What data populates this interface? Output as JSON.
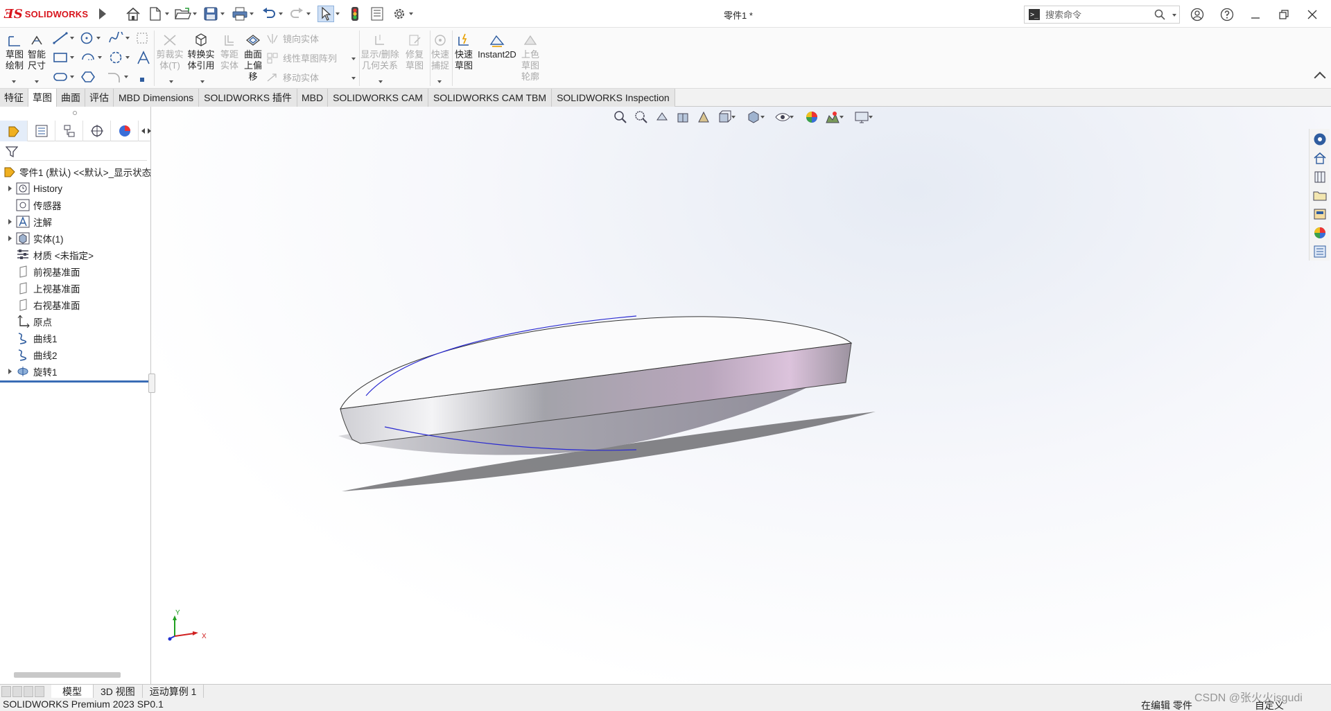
{
  "app": {
    "logo_ds": "ƎS",
    "logo_text": "SOLIDWORKS",
    "document_title": "零件1 *"
  },
  "search": {
    "placeholder": "搜索命令"
  },
  "command_manager": {
    "sketch_label": "草图\n绘制",
    "smart_dim_label": "智能\n尺寸",
    "trim_label": "剪裁实\n体(T)",
    "convert_label": "转换实\n体引用",
    "offset_label": "等距\n实体",
    "surface_offset_label": "曲面\n上偏\n移",
    "mirror_label": "镜向实体",
    "linear_pattern_label": "线性草图阵列",
    "move_label": "移动实体",
    "show_relations_label": "显示/删除\n几何关系",
    "repair_label": "修复\n草图",
    "quick_snap_label": "快速\n捕捉",
    "rapid_sketch_label": "快速\n草图",
    "instant2d_label": "Instant2D",
    "shaded_sketch_label": "上色\n草图\n轮廓"
  },
  "tabs": [
    {
      "label": "特征"
    },
    {
      "label": "草图"
    },
    {
      "label": "曲面"
    },
    {
      "label": "评估"
    },
    {
      "label": "MBD Dimensions"
    },
    {
      "label": "SOLIDWORKS 插件"
    },
    {
      "label": "MBD"
    },
    {
      "label": "SOLIDWORKS CAM"
    },
    {
      "label": "SOLIDWORKS CAM TBM"
    },
    {
      "label": "SOLIDWORKS Inspection"
    }
  ],
  "active_tab": "草图",
  "feature_tree": {
    "root": "零件1 (默认) <<默认>_显示状态",
    "items": [
      {
        "label": "History",
        "icon": "history-icon"
      },
      {
        "label": "传感器",
        "icon": "sensor-icon"
      },
      {
        "label": "注解",
        "icon": "annotation-icon"
      },
      {
        "label": "实体(1)",
        "icon": "solid-bodies-icon"
      },
      {
        "label": "材质 <未指定>",
        "icon": "material-icon"
      },
      {
        "label": "前视基准面",
        "icon": "plane-icon"
      },
      {
        "label": "上视基准面",
        "icon": "plane-icon"
      },
      {
        "label": "右视基准面",
        "icon": "plane-icon"
      },
      {
        "label": "原点",
        "icon": "origin-icon"
      },
      {
        "label": "曲线1",
        "icon": "curve-icon"
      },
      {
        "label": "曲线2",
        "icon": "curve-icon"
      },
      {
        "label": "旋转1",
        "icon": "revolve-icon"
      }
    ]
  },
  "bottom_tabs": [
    {
      "label": "模型"
    },
    {
      "label": "3D 视图"
    },
    {
      "label": "运动算例 1"
    }
  ],
  "status": {
    "product": "SOLIDWORKS Premium 2023 SP0.1",
    "editing": "在编辑 零件",
    "custom": "自定义"
  },
  "watermark": "CSDN @张火火isgudi",
  "triad": {
    "x": "X",
    "y": "Y"
  },
  "colors": {
    "accent": "#3a6db5",
    "logo_red": "#d8141c",
    "curve_blue": "#2a2ad0"
  }
}
